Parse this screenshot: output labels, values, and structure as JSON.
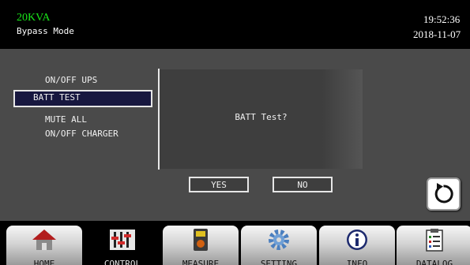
{
  "header": {
    "model": "20KVA",
    "mode": "Bypass Mode",
    "time": "19:52:36",
    "date": "2018-11-07"
  },
  "menu": {
    "items": [
      {
        "label": "ON/OFF UPS"
      },
      {
        "label": "BATT TEST"
      },
      {
        "label": "MUTE ALL"
      },
      {
        "label": "ON/OFF CHARGER"
      }
    ],
    "selected": "BATT TEST"
  },
  "dialog": {
    "prompt": "BATT Test?",
    "yes_label": "YES",
    "no_label": "NO"
  },
  "back_button": {
    "icon": "refresh-icon"
  },
  "nav": {
    "tabs": [
      {
        "label": "HOME",
        "icon": "home-icon"
      },
      {
        "label": "CONTROL",
        "icon": "sliders-icon"
      },
      {
        "label": "MEASURE",
        "icon": "meter-icon"
      },
      {
        "label": "SETTING",
        "icon": "gear-icon"
      },
      {
        "label": "INFO",
        "icon": "info-icon"
      },
      {
        "label": "DATALOG",
        "icon": "clipboard-icon"
      }
    ],
    "active": "CONTROL"
  },
  "colors": {
    "model_text": "#19e619",
    "panel_bg": "#4a4a4a",
    "selected_bg": "#17173f"
  }
}
